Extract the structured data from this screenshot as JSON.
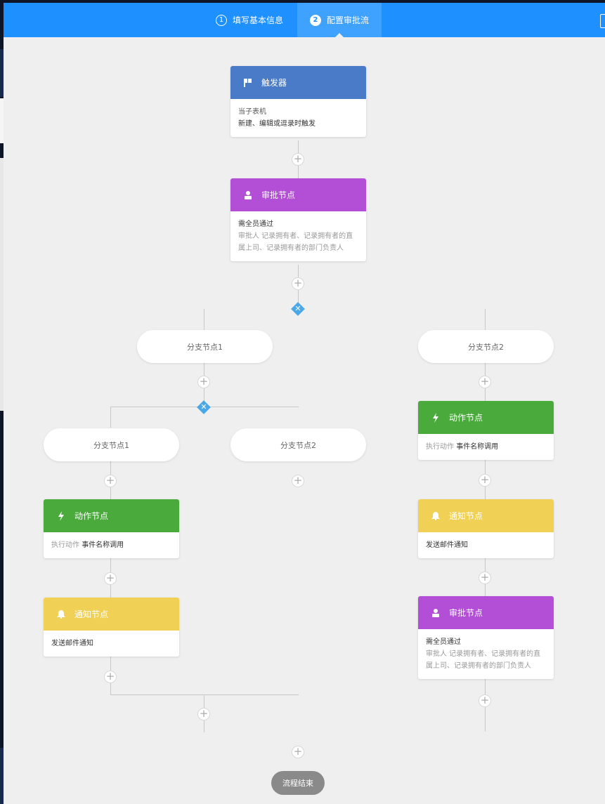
{
  "steps": [
    {
      "num": "1",
      "label": "填写基本信息"
    },
    {
      "num": "2",
      "label": "配置审批流"
    }
  ],
  "colors": {
    "topbar": "#1e90ff",
    "trigger": "#4a7bc8",
    "approval": "#b24fd6",
    "action": "#4aab3c",
    "notify": "#f0d156",
    "diamond": "#4aa8e8"
  },
  "trigger": {
    "title": "触发器",
    "line1": "当子表机",
    "line2": "新建、编辑或逗录时触发",
    "icon": "flag-icon"
  },
  "approval_main": {
    "title": "审批节点",
    "line1": "需全员通过",
    "line2": "审批人 记录拥有者、记录拥有者的直属上司、记录拥有者的部门负责人",
    "icon": "user-icon"
  },
  "branch_level1": [
    "分支节点1",
    "分支节点2"
  ],
  "branch_level2": [
    "分支节点1",
    "分支节点2"
  ],
  "left_action": {
    "title": "动作节点",
    "prefix": "执行动作",
    "value": "事件名称调用",
    "icon": "bolt-icon"
  },
  "left_notify": {
    "title": "通知节点",
    "line1": "发送邮件通知",
    "icon": "bell-icon"
  },
  "right_action": {
    "title": "动作节点",
    "prefix": "执行动作",
    "value": "事件名称调用",
    "icon": "bolt-icon"
  },
  "right_notify": {
    "title": "通知节点",
    "line1": "发送邮件通知",
    "icon": "bell-icon"
  },
  "right_approval": {
    "title": "审批节点",
    "line1": "需全员通过",
    "line2": "审批人 记录拥有者、记录拥有者的直属上司、记录拥有者的部门负责人",
    "icon": "user-icon"
  },
  "plus_symbol": "+",
  "diamond_symbol": "✕",
  "end_label": "流程结束"
}
